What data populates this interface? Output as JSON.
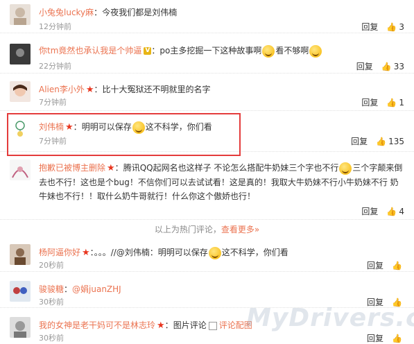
{
  "colors": {
    "username": "#eb7350",
    "highlight_border": "#e43b3b",
    "star": "#e8361f"
  },
  "comments": [
    {
      "user": "小兔兔lucky麻",
      "text": "今夜我们都是刘伟楠",
      "time": "12分钟前",
      "reply": "回复",
      "likes": "3",
      "avatar_icon": "avatar-icon"
    },
    {
      "user": "你tm竟然也承认我是个帅逼",
      "text_a": "po主多挖掘一下这种故事啊",
      "text_b": "看不够啊",
      "time": "22分钟前",
      "reply": "回复",
      "likes": "33"
    },
    {
      "user": "Alien李小外",
      "text": "比十大冤狱还不明就里的名字",
      "time": "7分钟前",
      "reply": "回复",
      "likes": "1"
    },
    {
      "user": "刘伟楠",
      "text_a": "明明可以保存",
      "text_b": "这不科学，你们看",
      "time": "7分钟前",
      "reply": "回复",
      "likes": "135"
    },
    {
      "user": "抱歉已被博主删除",
      "text_a": "腾讯QQ起网名也这样子 不论怎么搭配牛奶妹三个字也不行",
      "text_b": "三个字颠来倒去也不行！这也是个bug！不信你们可以去试试看！这是真的！我取大牛奶妹不行小牛奶妹不行 奶牛妹也不行！！取什么奶牛哥就行！什么你这个傲娇也行！",
      "time": "",
      "reply": "回复",
      "likes": "4"
    },
    {
      "user": "杨阿逼你好",
      "text_a": "。。。//@刘伟楠：明明可以保存",
      "text_b": "这不科学，你们看",
      "time": "20秒前",
      "reply": "回复",
      "likes": ""
    },
    {
      "user": "骏骏糖",
      "text": "@娟juanZHJ",
      "time": "30秒前",
      "reply": "回复",
      "likes": ""
    },
    {
      "user": "我的女神是老干妈可不是林志玲",
      "text": "图片评论",
      "link": "评论配图",
      "time": "30秒前",
      "reply": "回复",
      "likes": ""
    }
  ],
  "divider": {
    "text": "以上为热门评论，",
    "more": "查看更多»"
  },
  "watermark": "MyDrivers.com"
}
